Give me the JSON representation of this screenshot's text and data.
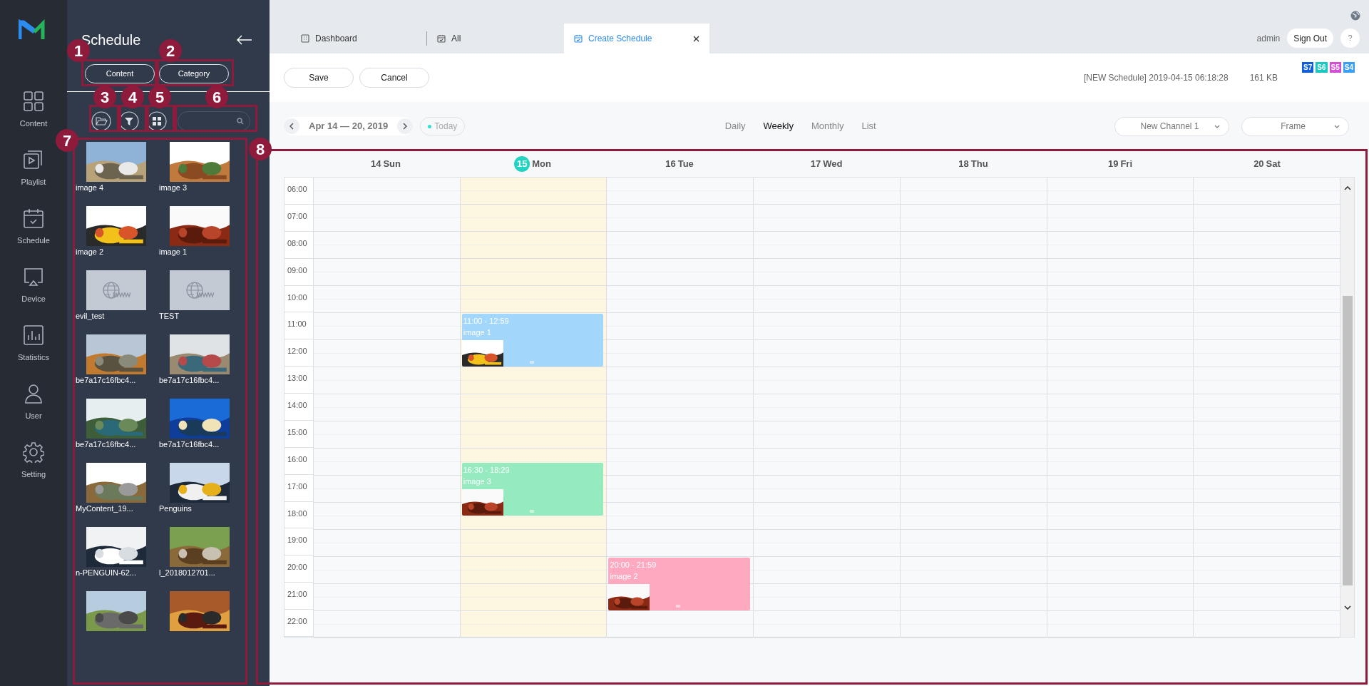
{
  "nav": {
    "items": [
      {
        "label": "Content"
      },
      {
        "label": "Playlist"
      },
      {
        "label": "Schedule"
      },
      {
        "label": "Device"
      },
      {
        "label": "Statistics"
      },
      {
        "label": "User"
      },
      {
        "label": "Setting"
      }
    ]
  },
  "sidebar": {
    "title": "Schedule",
    "tabs": [
      {
        "label": "Content"
      },
      {
        "label": "Category"
      }
    ],
    "items": [
      {
        "label": "image 4",
        "kind": "picture"
      },
      {
        "label": "image 3",
        "kind": "picture"
      },
      {
        "label": "image 2",
        "kind": "picture"
      },
      {
        "label": "image 1",
        "kind": "picture"
      },
      {
        "label": "evil_test",
        "kind": "web"
      },
      {
        "label": "TEST",
        "kind": "web"
      },
      {
        "label": "be7a17c16fbc4...",
        "kind": "picture"
      },
      {
        "label": "be7a17c16fbc4...",
        "kind": "picture"
      },
      {
        "label": "be7a17c16fbc4...",
        "kind": "picture"
      },
      {
        "label": "be7a17c16fbc4...",
        "kind": "picture"
      },
      {
        "label": "MyContent_19...",
        "kind": "picture"
      },
      {
        "label": "Penguins",
        "kind": "picture"
      },
      {
        "label": "n-PENGUIN-62...",
        "kind": "picture"
      },
      {
        "label": "l_2018012701...",
        "kind": "picture"
      },
      {
        "kind": "picture"
      },
      {
        "kind": "picture"
      }
    ]
  },
  "tabs": [
    {
      "label": "Dashboard",
      "selected": false
    },
    {
      "label": "All",
      "selected": false
    },
    {
      "label": "Create Schedule",
      "selected": true
    }
  ],
  "user": {
    "name": "admin",
    "sign_out": "Sign Out",
    "help": "?"
  },
  "toolbar": {
    "buttons": [
      "Save",
      "Cancel"
    ],
    "info": "[NEW Schedule] 2019-04-15 06:18:28",
    "size": "161 KB",
    "badges": [
      {
        "label": "S7",
        "color": "#0d5ed8"
      },
      {
        "label": "S6",
        "color": "#18c9c0"
      },
      {
        "label": "S5",
        "color": "#d24fd6"
      },
      {
        "label": "S4",
        "color": "#3aa0f5"
      }
    ]
  },
  "calendar": {
    "range": "Apr 14 — 20, 2019",
    "today": "Today",
    "views": [
      {
        "label": "Daily",
        "selected": false
      },
      {
        "label": "Weekly",
        "selected": true
      },
      {
        "label": "Monthly",
        "selected": false
      },
      {
        "label": "List",
        "selected": false
      }
    ],
    "channel": "New Channel 1",
    "frame": "Frame",
    "hours": [
      "06:00",
      "07:00",
      "08:00",
      "09:00",
      "10:00",
      "11:00",
      "12:00",
      "13:00",
      "14:00",
      "15:00",
      "16:00",
      "17:00",
      "18:00",
      "19:00",
      "20:00",
      "21:00",
      "22:00"
    ],
    "days": [
      {
        "date": "14",
        "weekday": "Sun",
        "today": false
      },
      {
        "date": "15",
        "weekday": "Mon",
        "today": true,
        "events": [
          {
            "time": "11:00 - 12:59",
            "title": "image 1",
            "color": "#a2d6fb"
          },
          {
            "time": "16:30 - 18:29",
            "title": "image 3",
            "color": "#95ebbf"
          }
        ]
      },
      {
        "date": "16",
        "weekday": "Tue",
        "today": false,
        "events": [
          {
            "time": "20:00 - 21:59",
            "title": "image 2",
            "color": "#ffa9c1"
          }
        ]
      },
      {
        "date": "17",
        "weekday": "Wed",
        "today": false
      },
      {
        "date": "18",
        "weekday": "Thu",
        "today": false
      },
      {
        "date": "19",
        "weekday": "Fri",
        "today": false
      },
      {
        "date": "20",
        "weekday": "Sat",
        "today": false
      }
    ]
  },
  "callouts": [
    {
      "number": "1"
    },
    {
      "number": "2"
    },
    {
      "number": "3"
    },
    {
      "number": "4"
    },
    {
      "number": "5"
    },
    {
      "number": "6"
    },
    {
      "number": "7"
    },
    {
      "number": "8"
    }
  ]
}
